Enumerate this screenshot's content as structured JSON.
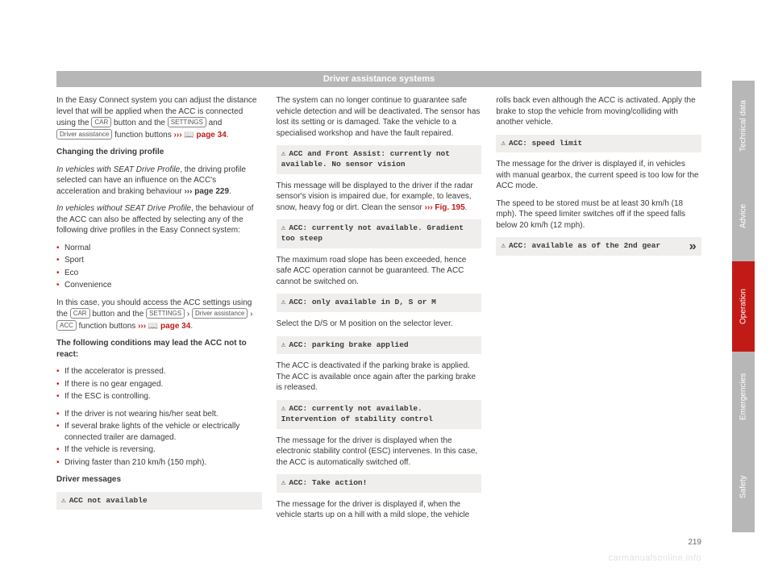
{
  "header": {
    "title": "Driver assistance systems"
  },
  "page_number": "219",
  "watermark": "carmanualsonline.info",
  "tabs": [
    "Technical data",
    "Advice",
    "Operation",
    "Emergencies",
    "Safety"
  ],
  "col1": {
    "intro_a": "In the Easy Connect system you can adjust the distance level that will be applied when the ACC is connected using the ",
    "btn_car": "CAR",
    "intro_b": " button and the ",
    "btn_settings": "SETTINGS",
    "intro_c": " and ",
    "btn_da": "Driver assistance",
    "intro_d": " function buttons ",
    "intro_ref": "››› 📖 page 34",
    "intro_e": ".",
    "h_changing": "Changing the driving profile",
    "with_a": "In vehicles with SEAT Drive Profile",
    "with_b": ", the driving profile selected can have an influence on the ACC's acceleration and braking behaviour ",
    "with_ref": "››› page 229",
    "with_c": ".",
    "without_a": "In vehicles without SEAT Drive Profile",
    "without_b": ", the behaviour of the ACC can also be affected by selecting any of the following drive profiles in the Easy Connect system:",
    "profiles": [
      "Normal",
      "Sport",
      "Eco",
      "Convenience"
    ],
    "set_a": "In this case, you should access the ACC settings using the ",
    "set_b": " button and the ",
    "set_c": " › ",
    "set_d": " › ",
    "btn_acc": "ACC",
    "set_e": " function buttons ",
    "set_ref": "››› 📖 page 34",
    "set_f": ".",
    "h_noreact": "The following conditions may lead the ACC not to react:",
    "noreact": [
      "If the accelerator is pressed.",
      "If there is no gear engaged.",
      "If the ESC is controlling."
    ]
  },
  "col2": {
    "noreact2": [
      "If the driver is not wearing his/her seat belt.",
      "If several brake lights of the vehicle or electrically connected trailer are damaged.",
      "If the vehicle is reversing.",
      "Driving faster than 210 km/h (150 mph)."
    ],
    "h_driver_msgs": "Driver messages",
    "msg1": "ACC not available",
    "msg1_body": "The system can no longer continue to guarantee safe vehicle detection and will be deactivated. The sensor has lost its setting or is damaged. Take the vehicle to a specialised workshop and have the fault repaired.",
    "msg2": "ACC and Front Assist: currently not available. No sensor vision",
    "msg2_body_a": "This message will be displayed to the driver if the radar sensor's vision is impaired due, for example, to leaves, snow, heavy fog or dirt. Clean the sensor ",
    "msg2_ref": "››› Fig. 195",
    "msg2_body_b": ".",
    "msg3": "ACC: currently not available. Gradient too steep",
    "msg3_body": "The maximum road slope has been exceeded, hence safe ACC operation cannot be guaranteed. The ACC cannot be switched on.",
    "msg4": "ACC: only available in D, S or M",
    "msg4_body": "Select the D/S or M position on the selector lever."
  },
  "col3": {
    "msg5": "ACC: parking brake applied",
    "msg5_body": "The ACC is deactivated if the parking brake is applied. The ACC is available once again after the parking brake is released.",
    "msg6": "ACC: currently not available. Intervention of stability control",
    "msg6_body": "The message for the driver is displayed when the electronic stability control (ESC) intervenes. In this case, the ACC is automatically switched off.",
    "msg7": "ACC: Take action!",
    "msg7_body": "The message for the driver is displayed if, when the vehicle starts up on a hill with a mild slope, the vehicle rolls back even although the ACC is activated. Apply the brake to stop the vehicle from moving/colliding with another vehicle.",
    "msg8": "ACC: speed limit",
    "msg8_body_a": "The message for the driver is displayed if, in vehicles with manual gearbox, the current speed is too low for the ACC mode.",
    "msg8_body_b": "The speed to be stored must be at least 30 km/h (18 mph). The speed limiter switches off if the speed falls below 20 km/h (12 mph).",
    "msg9": "ACC: available as of the 2nd gear",
    "cont": "»"
  }
}
